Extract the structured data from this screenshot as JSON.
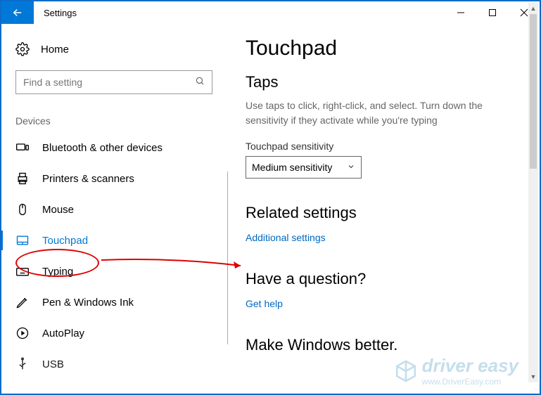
{
  "window": {
    "title": "Settings"
  },
  "left": {
    "home": "Home",
    "search_placeholder": "Find a setting",
    "category": "Devices",
    "items": [
      {
        "label": "Bluetooth & other devices"
      },
      {
        "label": "Printers & scanners"
      },
      {
        "label": "Mouse"
      },
      {
        "label": "Touchpad"
      },
      {
        "label": "Typing"
      },
      {
        "label": "Pen & Windows Ink"
      },
      {
        "label": "AutoPlay"
      },
      {
        "label": "USB"
      }
    ]
  },
  "right": {
    "title": "Touchpad",
    "taps_heading": "Taps",
    "taps_desc": "Use taps to click, right-click, and select. Turn down the sensitivity if they activate while you're typing",
    "sensitivity_label": "Touchpad sensitivity",
    "sensitivity_value": "Medium sensitivity",
    "related_heading": "Related settings",
    "related_link": "Additional settings",
    "question_heading": "Have a question?",
    "question_link": "Get help",
    "better_heading": "Make Windows better."
  },
  "watermark": {
    "brand": "driver easy",
    "url": "www.DriverEasy.com"
  }
}
